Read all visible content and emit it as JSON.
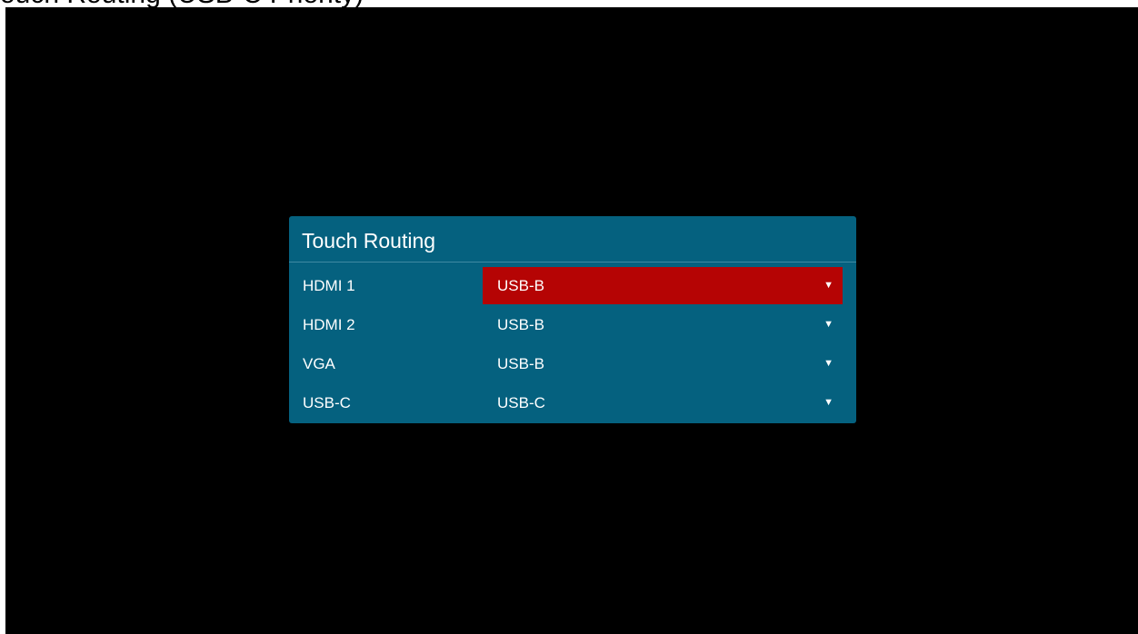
{
  "page": {
    "top_caption": "ouch Routing (USB-C Priority)"
  },
  "dialog": {
    "title": "Touch Routing",
    "rows": [
      {
        "label": "HDMI 1",
        "value": "USB-B",
        "selected": true
      },
      {
        "label": "HDMI 2",
        "value": "USB-B",
        "selected": false
      },
      {
        "label": "VGA",
        "value": "USB-B",
        "selected": false
      },
      {
        "label": "USB-C",
        "value": "USB-C",
        "selected": false
      }
    ],
    "dropdown_icon": "triangle-down-icon"
  },
  "colors": {
    "background": "#000000",
    "dialog": "#05617f",
    "selected": "#b50404",
    "text": "#ffffff"
  }
}
